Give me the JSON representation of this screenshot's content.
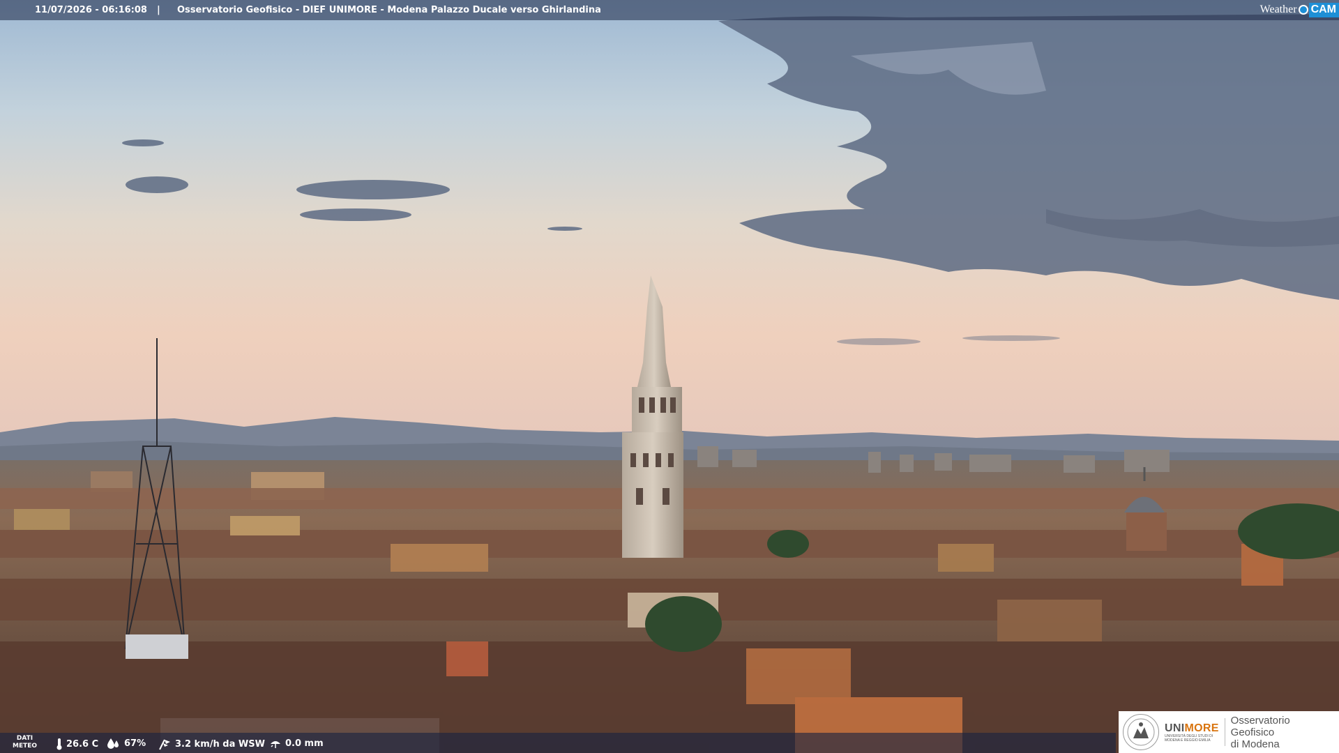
{
  "overlay": {
    "timestamp": "11/07/2026 - 06:16:08",
    "separator": "|",
    "title": "Osservatorio Geofisico - DIEF UNIMORE - Modena Palazzo Ducale verso Ghirlandina"
  },
  "brand": {
    "weather": "Weather",
    "cam": "CAM"
  },
  "meteo": {
    "label_line1": "DATI",
    "label_line2": "METEO",
    "temperature": "26.6 C",
    "humidity": "67%",
    "wind": "3.2 km/h da WSW",
    "rain": "0.0 mm"
  },
  "logo": {
    "uni_prefix": "UNI",
    "uni_suffix": "MORE",
    "uni_sub_1": "UNIVERSITÀ DEGLI STUDI DI",
    "uni_sub_2": "MODENA E REGGIO EMILIA",
    "obs_line1": "Osservatorio Geofisico",
    "obs_line2": "di Modena"
  },
  "icons": {
    "temperature": "thermometer-icon",
    "humidity": "droplet-icon",
    "wind": "wind-icon",
    "rain": "rain-icon",
    "brand": "weathercam-logo",
    "seal": "university-seal-icon"
  },
  "colors": {
    "bar": "#1e2846",
    "brand_blue": "#1e8fd6",
    "unimore_orange": "#d9740f"
  }
}
